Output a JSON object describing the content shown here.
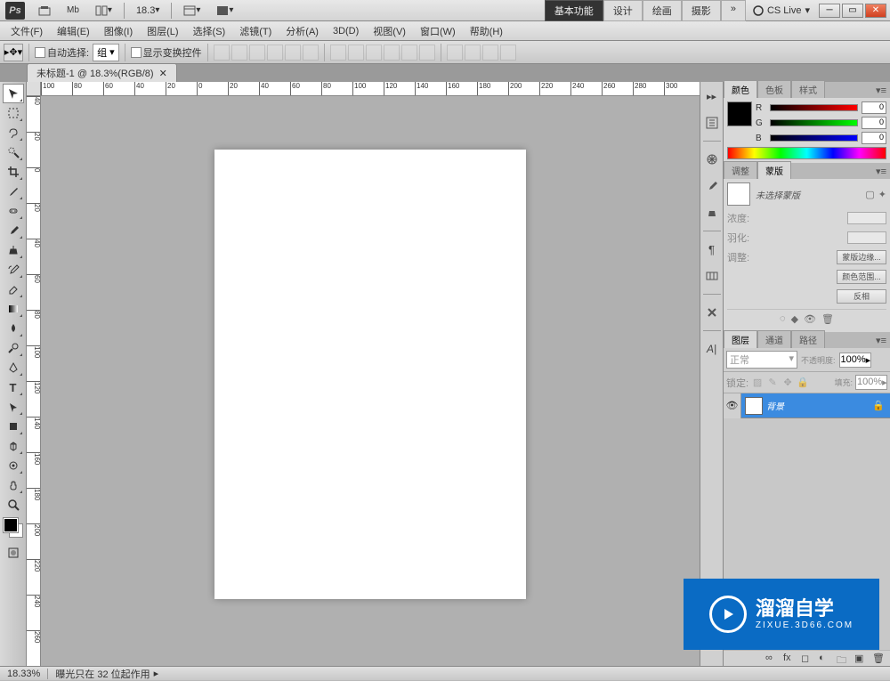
{
  "app": {
    "logo": "Ps"
  },
  "top": {
    "zoom_view": "18.3",
    "workspace_tabs": [
      "基本功能",
      "设计",
      "绘画",
      "摄影"
    ],
    "more": "»",
    "cs_live": "CS Live"
  },
  "menu": [
    "文件(F)",
    "编辑(E)",
    "图像(I)",
    "图层(L)",
    "选择(S)",
    "滤镜(T)",
    "分析(A)",
    "3D(D)",
    "视图(V)",
    "窗口(W)",
    "帮助(H)"
  ],
  "options": {
    "auto_select": "自动选择:",
    "group": "组",
    "show_transform": "显示变换控件"
  },
  "doc_tab": {
    "title": "未标题-1 @ 18.3%(RGB/8)"
  },
  "ruler_h": [
    "100",
    "80",
    "60",
    "40",
    "20",
    "0",
    "20",
    "40",
    "60",
    "80",
    "100",
    "120",
    "140",
    "160",
    "180",
    "200",
    "220",
    "240",
    "260",
    "280",
    "300"
  ],
  "ruler_v": [
    "40",
    "20",
    "0",
    "20",
    "40",
    "60",
    "80",
    "100",
    "120",
    "140",
    "160",
    "180",
    "200",
    "220",
    "240",
    "260"
  ],
  "panels": {
    "color": {
      "tabs": [
        "颜色",
        "色板",
        "样式"
      ],
      "r": "R",
      "g": "G",
      "b": "B",
      "r_val": "0",
      "g_val": "0",
      "b_val": "0"
    },
    "mask": {
      "tabs": [
        "调整",
        "蒙版"
      ],
      "no_mask": "未选择蒙版",
      "density": "浓度:",
      "feather": "羽化:",
      "adjust": "调整:",
      "edge_btn": "蒙版边缘...",
      "color_range_btn": "颜色范围...",
      "invert_btn": "反相"
    },
    "layers": {
      "tabs": [
        "图层",
        "通道",
        "路径"
      ],
      "blend": "正常",
      "opacity_label": "不透明度:",
      "opacity_val": "100%",
      "lock_label": "锁定:",
      "fill_label": "填充:",
      "fill_val": "100%",
      "layer_name": "背景"
    }
  },
  "status": {
    "zoom": "18.33%",
    "info": "曝光只在 32 位起作用"
  },
  "watermark": {
    "title": "溜溜自学",
    "url": "ZIXUE.3D66.COM"
  }
}
